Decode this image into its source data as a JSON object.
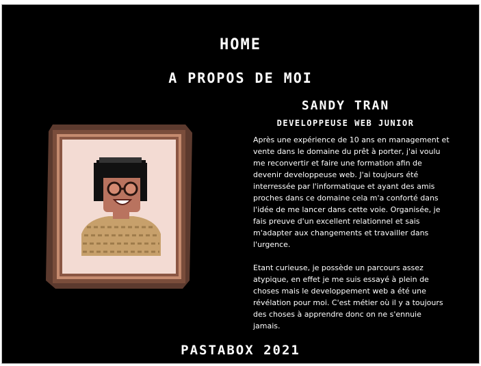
{
  "nav": {
    "home_label": "HOME"
  },
  "section": {
    "title": "A PROPOS DE MOI"
  },
  "profile": {
    "name": "SANDY TRAN",
    "role": "DEVELOPPEUSE WEB JUNIOR",
    "bio_paragraph_1": "Après une expérience de 10 ans en management et vente dans le domaine du prêt à porter, j'ai voulu me reconvertir et faire une formation afin de devenir developpeuse web. J'ai toujours été interressée par l'informatique et ayant des amis proches dans ce domaine cela m'a conforté dans l'idée de me lancer dans cette voie. Organisée, je fais preuve d'un excellent relationnel et sais m'adapter aux changements et travailler dans l'urgence.",
    "bio_paragraph_2": "Etant curieuse, je possède un parcours assez atypique, en effet je me suis essayé à plein de choses mais le developpement web a été une révélation pour moi. C'est métier où il y a toujours des choses à apprendre donc on ne s'ennuie jamais."
  },
  "footer": {
    "text": "PASTABOX 2021"
  },
  "colors": {
    "background": "#000000",
    "text": "#ffffff",
    "frame_wood": "#6b4234",
    "frame_inner": "#c58b6f",
    "mat": "#f3dbd3",
    "skin": "#b9735f",
    "hair": "#111111",
    "sweater": "#c7a06b"
  },
  "icons": {
    "portrait": "pixel-art-portrait-icon"
  }
}
